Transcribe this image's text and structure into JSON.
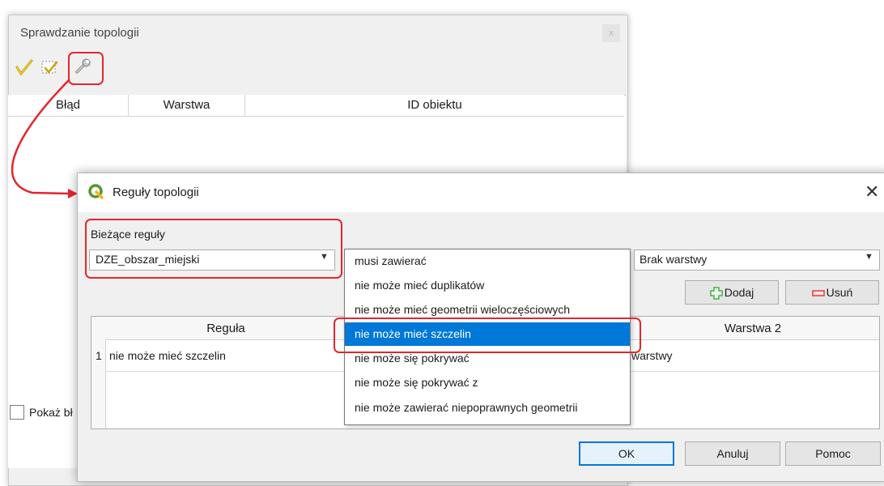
{
  "back_window": {
    "title": "Sprawdzanie topologii",
    "close_label": "x",
    "columns": [
      "Błąd",
      "Warstwa",
      "ID obiektu"
    ],
    "show_errors_label": "Pokaż bł"
  },
  "dialog": {
    "title": "Reguły topologii",
    "close_glyph": "✕",
    "current_rules_label": "Bieżące reguły",
    "layer1_value": "DZE_obszar_miejski",
    "layer2_value": "Brak warstwy",
    "add_label": "Dodaj",
    "remove_label": "Usuń",
    "table": {
      "col_rule": "Reguła",
      "col_layer2": "Warstwa 2",
      "rows": [
        {
          "num": "1",
          "rule": "nie może mieć szczelin",
          "layer2": "warstwy"
        }
      ]
    },
    "ok_label": "OK",
    "cancel_label": "Anuluj",
    "help_label": "Pomoc"
  },
  "rule_dropdown": {
    "selected_index": 3,
    "options": [
      "musi zawierać",
      "nie może mieć duplikatów",
      "nie może mieć geometrii wieloczęściowych",
      "nie może mieć szczelin",
      "nie może się pokrywać",
      "nie może się pokrywać z",
      "nie może zawierać niepoprawnych geometrii"
    ]
  },
  "colors": {
    "highlight": "#e3262e",
    "selection": "#0078d7",
    "qgis_green": "#589632",
    "add_green": "#4caf50",
    "remove_red": "#e53935"
  }
}
